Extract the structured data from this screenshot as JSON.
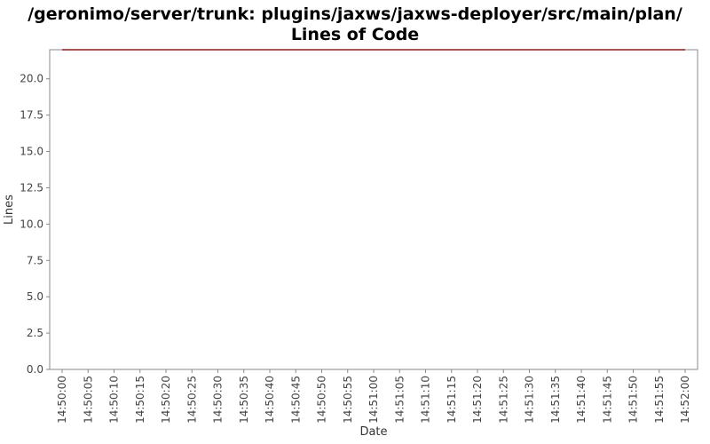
{
  "chart_data": {
    "type": "line",
    "title": "/geronimo/server/trunk: plugins/jaxws/jaxws-deployer/src/main/plan/",
    "subtitle": "Lines of Code",
    "xlabel": "Date",
    "ylabel": "Lines",
    "x_ticks": [
      "14:50:00",
      "14:50:05",
      "14:50:10",
      "14:50:15",
      "14:50:20",
      "14:50:25",
      "14:50:30",
      "14:50:35",
      "14:50:40",
      "14:50:45",
      "14:50:50",
      "14:50:55",
      "14:51:00",
      "14:51:05",
      "14:51:10",
      "14:51:15",
      "14:51:20",
      "14:51:25",
      "14:51:30",
      "14:51:35",
      "14:51:40",
      "14:51:45",
      "14:51:50",
      "14:51:55",
      "14:52:00"
    ],
    "y_ticks": [
      "0.0",
      "2.5",
      "5.0",
      "7.5",
      "10.0",
      "12.5",
      "15.0",
      "17.5",
      "20.0"
    ],
    "ylim": [
      0,
      22
    ],
    "series": [
      {
        "color": "#8b1a1a",
        "x": [
          "14:50:00",
          "14:52:00"
        ],
        "values": [
          22,
          22
        ]
      }
    ],
    "grid": false,
    "legend": "none"
  }
}
